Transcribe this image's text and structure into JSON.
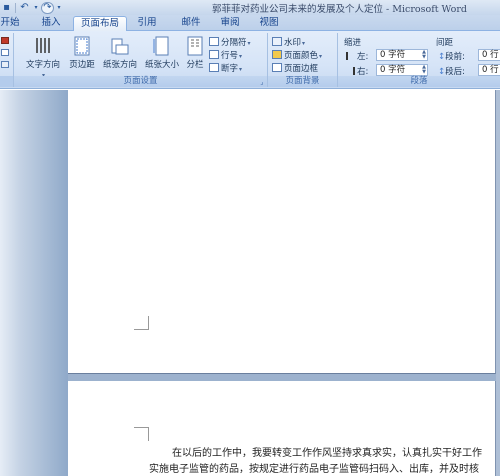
{
  "window": {
    "title": "郭菲菲对药业公司未来的发展及个人定位 - Microsoft Word"
  },
  "tabs": [
    {
      "label": "开始"
    },
    {
      "label": "插入"
    },
    {
      "label": "页面布局"
    },
    {
      "label": "引用"
    },
    {
      "label": "邮件"
    },
    {
      "label": "审阅"
    },
    {
      "label": "视图"
    }
  ],
  "active_tab": "页面布局",
  "ribbon": {
    "page_setup": {
      "group_label": "页面设置",
      "text_direction": "文字方向",
      "margins": "页边距",
      "orientation": "纸张方向",
      "size": "纸张大小",
      "columns": "分栏",
      "breaks": "分隔符",
      "line_numbers": "行号",
      "hyphenation": "断字"
    },
    "page_background": {
      "group_label": "页面背景",
      "watermark": "水印",
      "page_color": "页面颜色",
      "page_borders": "页面边框"
    },
    "paragraph": {
      "group_label": "段落",
      "indent_label": "缩进",
      "spacing_label": "间距",
      "indent_left_label": "左:",
      "indent_left_value": "0 字符",
      "indent_right_label": "右:",
      "indent_right_value": "0 字符",
      "spacing_before_label": "段前:",
      "spacing_before_value": "0 行",
      "spacing_after_label": "段后:",
      "spacing_after_value": "0 行"
    }
  },
  "document": {
    "line1": "在以后的工作中，我要转变工作作风坚持求真求实，认真扎实干好工作",
    "line2": "实施电子监管的药品，按规定进行药品电子监管码扫码入、出库，并及时核"
  },
  "colors": {
    "accent": "#15428b",
    "ribbon_bg": "#d6e4f7",
    "doc_bg": "#8fa7c6"
  }
}
